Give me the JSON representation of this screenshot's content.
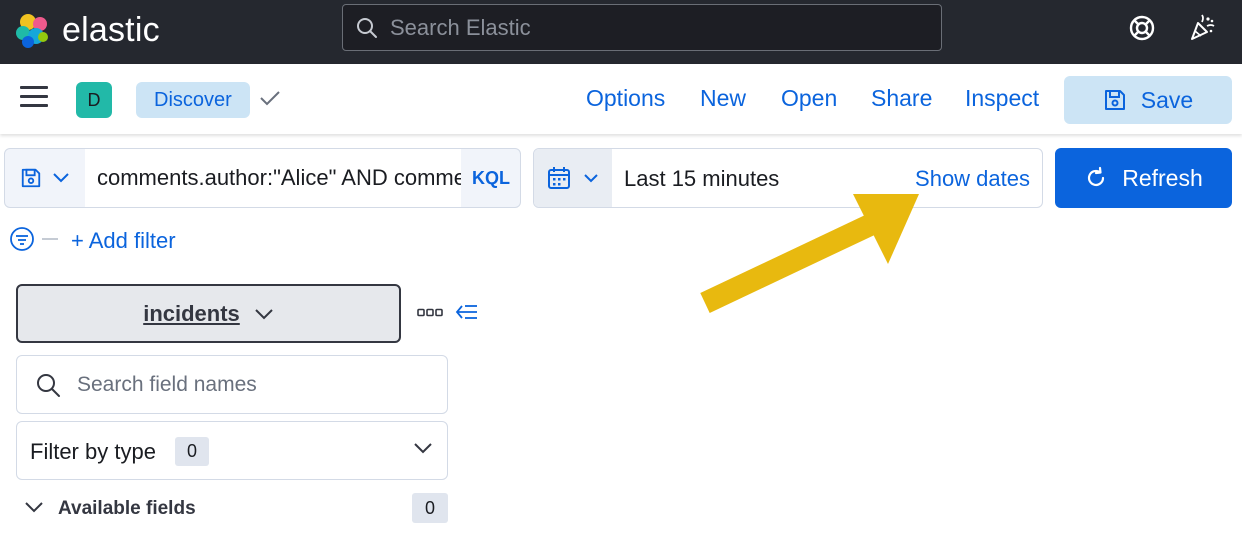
{
  "header": {
    "logo_text": "elastic",
    "search_placeholder": "Search Elastic",
    "icons": [
      "help-icon",
      "newsfeed-icon"
    ]
  },
  "appbar": {
    "space_initial": "D",
    "breadcrumb": "Discover",
    "nav": {
      "options": "Options",
      "new": "New",
      "open": "Open",
      "share": "Share",
      "inspect": "Inspect"
    },
    "save_label": "Save"
  },
  "query": {
    "value": "comments.author:\"Alice\" AND comments.text:*",
    "language": "KQL"
  },
  "date_picker": {
    "range": "Last 15 minutes",
    "show_dates": "Show dates"
  },
  "refresh_label": "Refresh",
  "filters": {
    "add_label": "+ Add filter"
  },
  "sidebar": {
    "index_pattern": "incidents",
    "field_search_placeholder": "Search field names",
    "filter_by_type": {
      "label": "Filter by type",
      "count": "0"
    },
    "available_fields": {
      "label": "Available fields",
      "count": "0"
    }
  },
  "colors": {
    "header_bg": "#25282f",
    "link_blue": "#0b64dd",
    "button_light": "#cce4f5",
    "refresh_bg": "#0b64dd",
    "arrow": "#e8b90f",
    "avatar_teal": "#22b9a8"
  }
}
